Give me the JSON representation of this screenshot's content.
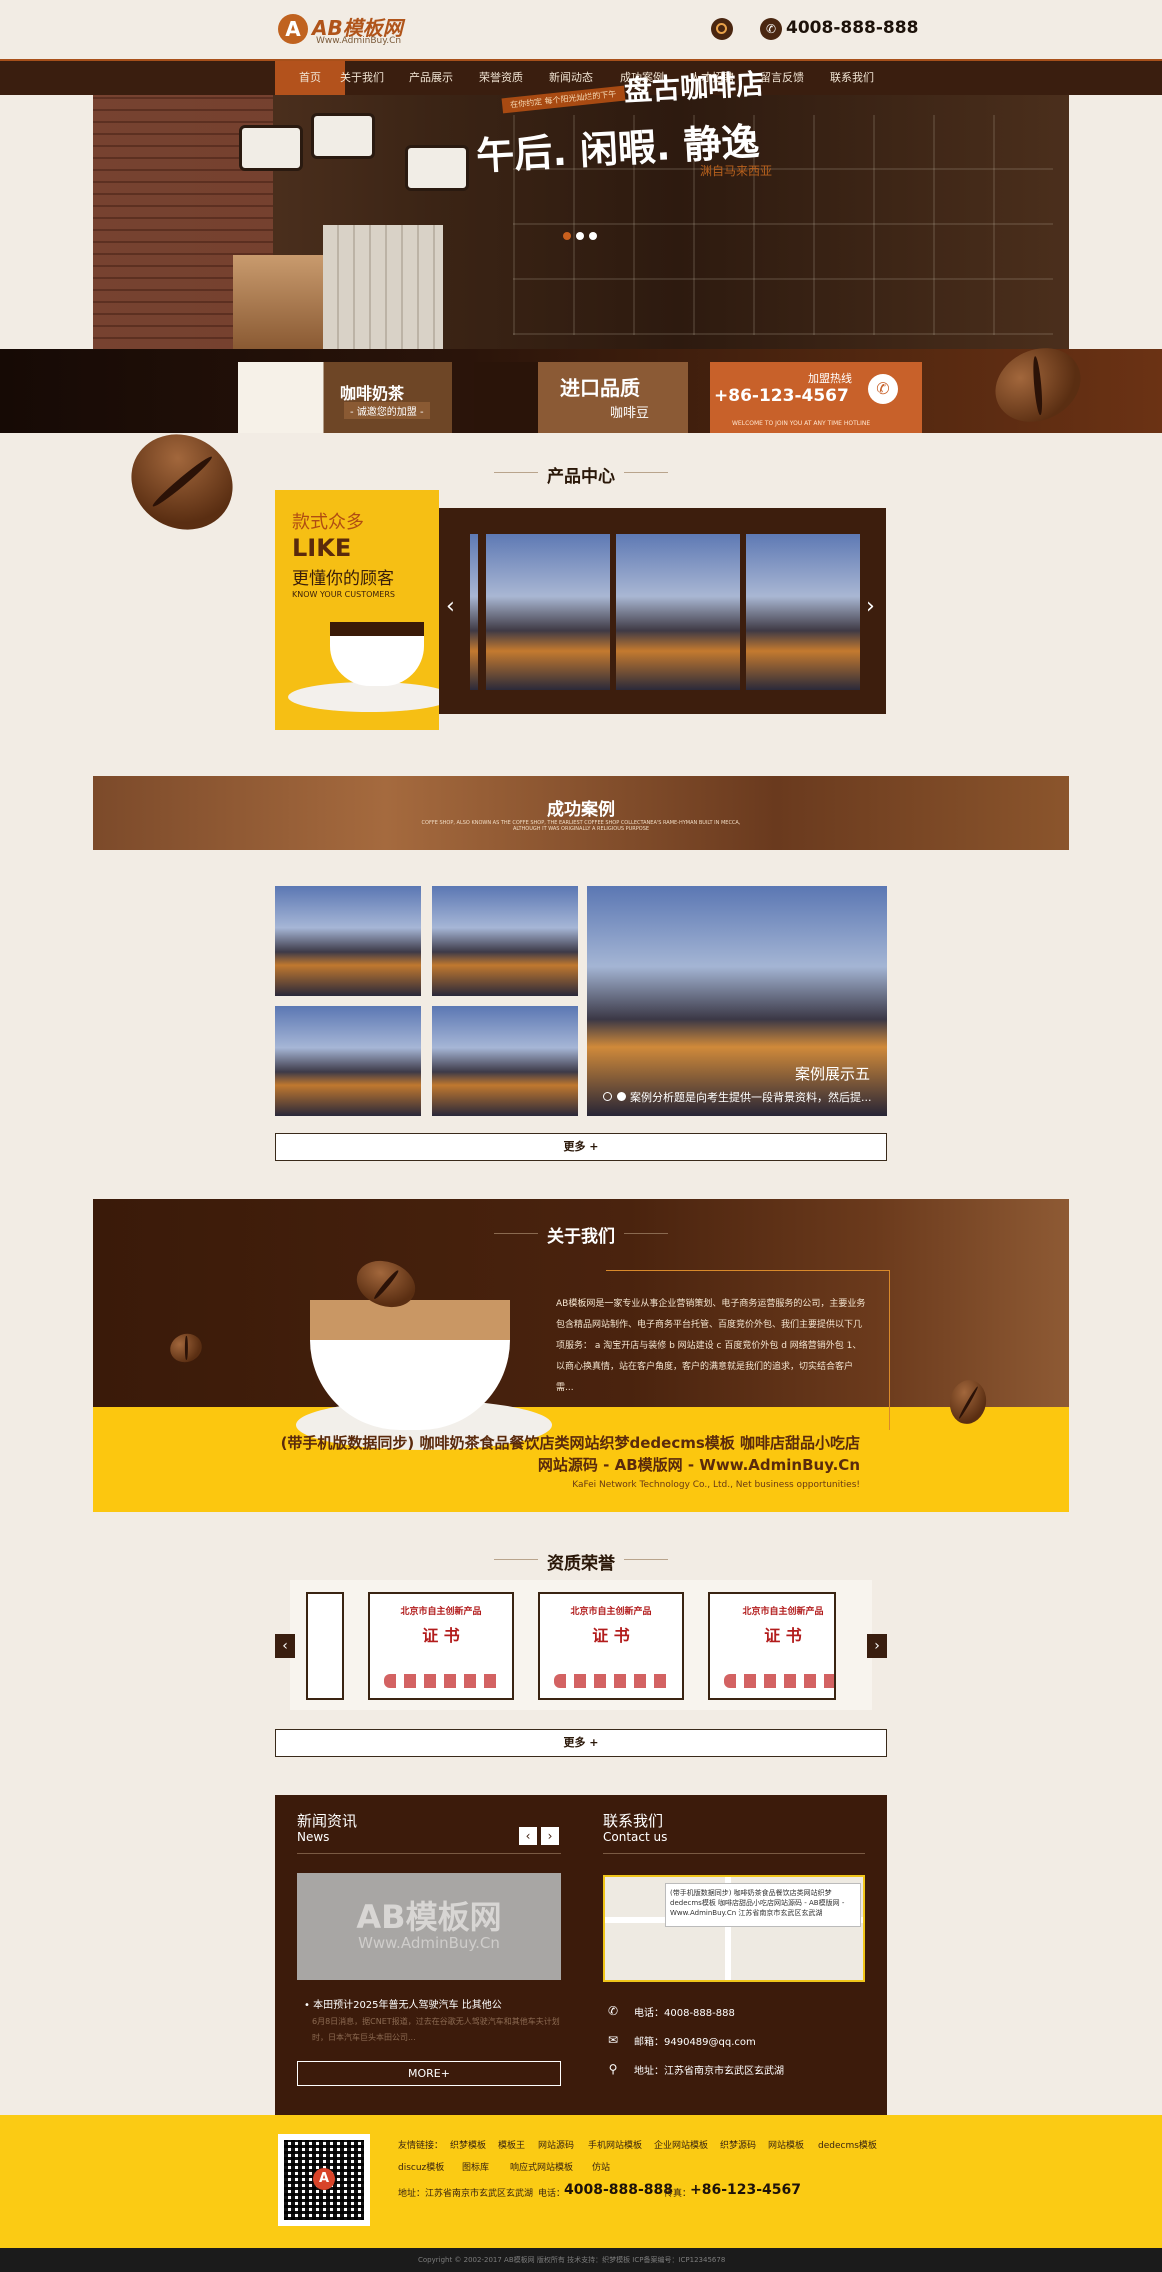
{
  "header": {
    "logo_mark": "A",
    "logo_text": "AB模板网",
    "logo_sub": "Www.AdminBuy.Cn",
    "hotline": "4008-888-888"
  },
  "nav": [
    "首页",
    "关于我们",
    "产品展示",
    "荣誉资质",
    "新闻动态",
    "成功案例",
    "人才招聘",
    "留言反馈",
    "联系我们"
  ],
  "banner": {
    "tag": "在你约定 每个阳光灿烂的下午",
    "title1": "盘古咖啡店",
    "title2": "午后. 闲暇. 静逸",
    "sub": "渊自马来西亚"
  },
  "ads": {
    "ad1_title": "咖啡奶茶",
    "ad1_sub": "- 诚邀您的加盟 -",
    "ad2_title": "进口品质",
    "ad2_sub": "咖啡豆",
    "ad3_label": "加盟热线",
    "ad3_phone": "+86-123-4567",
    "ad3_en": "WELCOME TO JOIN YOU AT ANY TIME HOTLINE"
  },
  "products": {
    "title": "产品中心",
    "promo_line1": "款式众多",
    "promo_line2": "LIKE",
    "promo_line3": "更懂你的顾客",
    "promo_line4": "KNOW YOUR CUSTOMERS",
    "prev": "‹",
    "next": "›"
  },
  "cases": {
    "title": "成功案例",
    "subtitle": "COFFE SHOP, ALSO KNOWN AS THE COFFE SHOP, THE EARLIEST COFFEE SHOP COLLECTANEA'S RAME-HYMAN BUILT IN MECCA, ALTHOUGH IT WAS ORIGINALLY A RELIGIOUS PURPOSE",
    "caption": "案例展示五",
    "desc": "案例分析题是向考生提供一段背景资料，然后提...",
    "more": "更多 +"
  },
  "about": {
    "title": "关于我们",
    "text": "AB模板网是一家专业从事企业营销策划、电子商务运营服务的公司，主要业务包含精品网站制作、电子商务平台托管、百度竞价外包、我们主要提供以下几项服务： a 淘宝开店与装修 b 网站建设 c 百度竞价外包 d 网络营销外包 1、以商心换真情，站在客户角度，客户的满意就是我们的追求，切实结合客户需...",
    "headline": "(带手机版数据同步) 咖啡奶茶食品餐饮店类网站织梦dedecms模板 咖啡店甜品小吃店网站源码 - AB模版网 - Www.AdminBuy.Cn",
    "en": "KaFei Network Technology Co., Ltd., Net business opportunities!"
  },
  "honors": {
    "title": "资质荣誉",
    "cert_top": "北京市自主创新产品",
    "cert_mid": "证 书",
    "prev": "‹",
    "next": "›",
    "more": "更多 +"
  },
  "news": {
    "title": "新闻资讯",
    "en": "News",
    "prev": "‹",
    "next": "›",
    "img_wm": "AB模板网",
    "img_wm2": "Www.AdminBuy.Cn",
    "headline": "• 本田预计2025年普无人驾驶汽车 比其他公",
    "summary": "6月8日消息，据CNET报道，过去在谷歌无人驾驶汽车和其他车夫计划时，日本汽车巨头本田公司...",
    "more": "MORE+"
  },
  "contact": {
    "title": "联系我们",
    "en": "Contact us",
    "map_popup": "(带手机版数据同步) 咖啡奶茶食品餐饮店类网站织梦dedecms模板 咖啡店甜品小吃店网站源码 - AB模版网 - Www.AdminBuy.Cn 江苏省南京市玄武区玄武湖",
    "phone": "电话：4008-888-888",
    "email": "邮箱：9490489@qq.com",
    "address": "地址：江苏省南京市玄武区玄武湖"
  },
  "footer": {
    "links_label": "友情链接：",
    "links": [
      "织梦模板",
      "模板王",
      "网站源码",
      "手机网站模板",
      "企业网站模板",
      "织梦源码",
      "网站模板",
      "dedecms模板",
      "discuz模板",
      "图标库",
      "响应式网站模板",
      "仿站"
    ],
    "address": "地址：江苏省南京市玄武区玄武湖",
    "tel_label": "电话：",
    "tel": "4008-888-888",
    "fax_label": "传真：",
    "fax": "+86-123-4567",
    "copyright": "Copyright © 2002-2017 AB模板网 版权所有    技术支持：织梦模板    ICP备案编号：ICP12345678"
  },
  "colors": {
    "accent": "#b3521c",
    "dark_brown": "#3c1b0b",
    "yellow": "#fbcb14",
    "background": "#f2ece4"
  },
  "icons": [
    "search-icon",
    "phone-icon",
    "email-icon",
    "location-icon",
    "arrow-left-icon",
    "arrow-right-icon"
  ]
}
